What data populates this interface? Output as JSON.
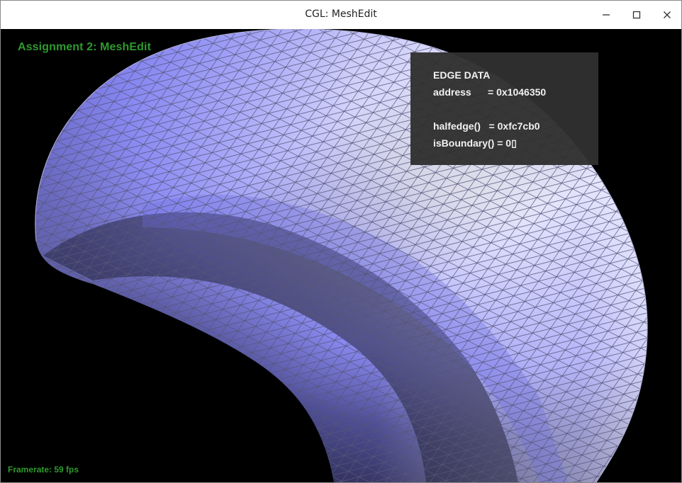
{
  "window": {
    "title": "CGL: MeshEdit",
    "controls": [
      "minimize-icon",
      "maximize-icon",
      "close-icon"
    ]
  },
  "hud": {
    "assignment_title": "Assignment 2: MeshEdit",
    "framerate": "Framerate: 59 fps"
  },
  "edge_info": {
    "heading": "EDGE DATA",
    "address": "address      = 0x1046350",
    "halfedge": "halfedge()   = 0xfc7cb0",
    "is_boundary": "isBoundary() = 0▯"
  },
  "colors": {
    "hud_text": "#2e9a2e",
    "mesh_light": "#ffffff",
    "mesh_mid": "#8c8cf5",
    "mesh_dark": "#2a2a44",
    "wireframe": "#606080",
    "background": "#000000"
  }
}
